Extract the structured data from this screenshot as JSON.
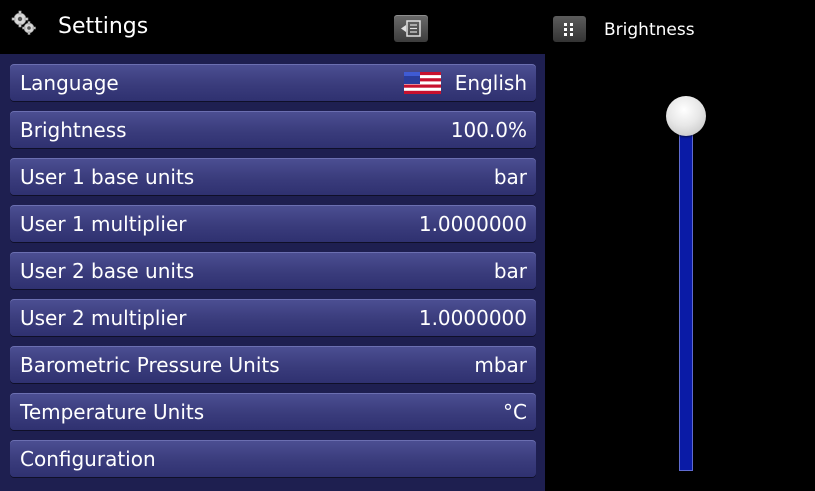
{
  "header": {
    "title": "Settings",
    "title_icon": "gear-icon",
    "back_icon": "back-icon"
  },
  "side_panel": {
    "title": "Brightness",
    "menu_icon": "grid-menu-icon",
    "brightness_level": 1.0
  },
  "settings": [
    {
      "label": "Language",
      "value": "English",
      "icon": "us-flag-icon"
    },
    {
      "label": "Brightness",
      "value": "100.0%"
    },
    {
      "label": "User 1 base units",
      "value": "bar"
    },
    {
      "label": "User 1 multiplier",
      "value": "1.0000000"
    },
    {
      "label": "User 2 base units",
      "value": "bar"
    },
    {
      "label": "User 2 multiplier",
      "value": "1.0000000"
    },
    {
      "label": "Barometric Pressure Units",
      "value": "mbar"
    },
    {
      "label": "Temperature Units",
      "value": "°C"
    },
    {
      "label": "Configuration",
      "value": ""
    }
  ],
  "colors": {
    "panel_background": "#1e1f50",
    "row_background": "#3a3c7c",
    "slider_track": "#0a1ba6"
  }
}
